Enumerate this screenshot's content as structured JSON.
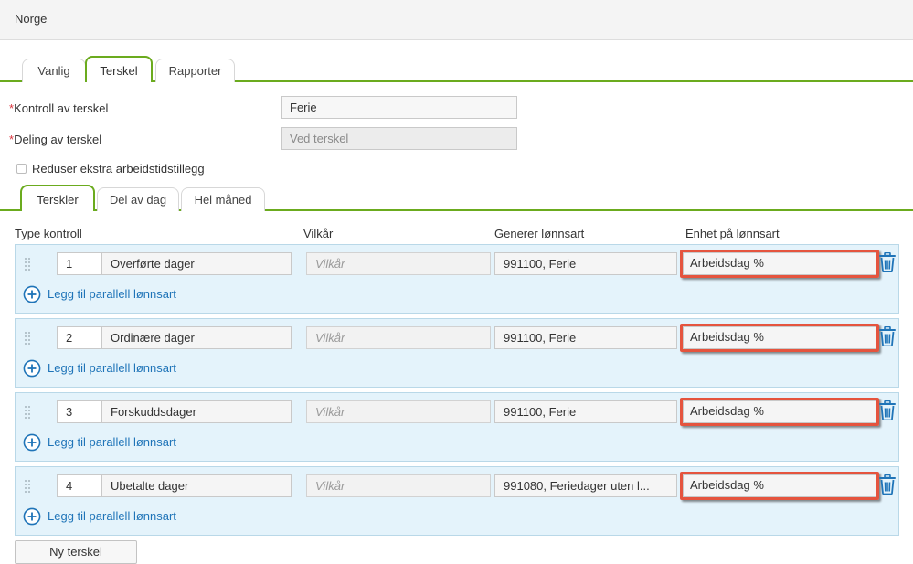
{
  "header": {
    "title": "Norge"
  },
  "top_tabs": [
    {
      "label": "Vanlig",
      "active": false
    },
    {
      "label": "Terskel",
      "active": true
    },
    {
      "label": "Rapporter",
      "active": false
    }
  ],
  "form": {
    "required_marker": "*",
    "kontroll": {
      "label": "Kontroll av terskel",
      "value": "Ferie"
    },
    "deling": {
      "label": "Deling av terskel",
      "value": "Ved terskel"
    },
    "checkbox": {
      "label": "Reduser ekstra arbeidstidstillegg",
      "checked": false
    }
  },
  "sub_tabs": [
    {
      "label": "Terskler",
      "active": true
    },
    {
      "label": "Del av dag",
      "active": false
    },
    {
      "label": "Hel måned",
      "active": false
    }
  ],
  "columns": {
    "type": "Type kontroll",
    "vilkar": "Vilkår",
    "lonnsart": "Generer lønnsart",
    "enhet": "Enhet på lønnsart"
  },
  "rows": [
    {
      "num": "1",
      "type": "Overførte dager",
      "vilkar_placeholder": "Vilkår",
      "lonnsart": "991100, Ferie",
      "enhet": "Arbeidsdag %",
      "add_label": "Legg til parallell lønnsart"
    },
    {
      "num": "2",
      "type": "Ordinære dager",
      "vilkar_placeholder": "Vilkår",
      "lonnsart": "991100, Ferie",
      "enhet": "Arbeidsdag %",
      "add_label": "Legg til parallell lønnsart"
    },
    {
      "num": "3",
      "type": "Forskuddsdager",
      "vilkar_placeholder": "Vilkår",
      "lonnsart": "991100, Ferie",
      "enhet": "Arbeidsdag %",
      "add_label": "Legg til parallell lønnsart"
    },
    {
      "num": "4",
      "type": "Ubetalte dager",
      "vilkar_placeholder": "Vilkår",
      "lonnsart": "991080, Feriedager uten l...",
      "enhet": "Arbeidsdag %",
      "add_label": "Legg til parallell lønnsart"
    }
  ],
  "new_button": {
    "label": "Ny terskel"
  },
  "colors": {
    "tab_accent": "#6bab1e",
    "row_background": "#e4f3fb",
    "link": "#1f74b8",
    "highlight_border": "#e5543e",
    "required": "#d9363e"
  },
  "icons": {
    "row_action": "trash-icon",
    "add": "plus-circle-icon",
    "drag": "drag-handle-icon"
  }
}
